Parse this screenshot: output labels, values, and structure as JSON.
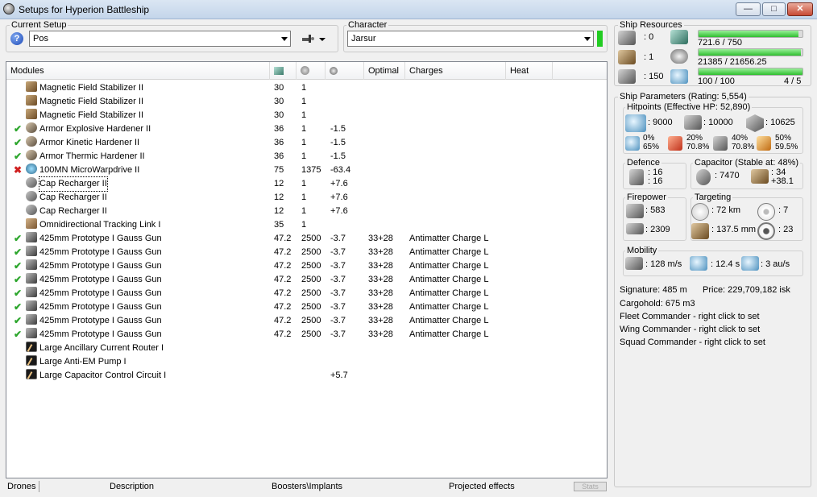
{
  "window": {
    "title": "Setups for Hyperion Battleship",
    "minimize": "—",
    "maximize": "□",
    "close": "✕"
  },
  "current_setup": {
    "label": "Current Setup",
    "value": "Pos",
    "help_icon": "?"
  },
  "character": {
    "label": "Character",
    "value": "Jarsur",
    "status_color": "#22cc22"
  },
  "modules": {
    "columns": [
      "Modules",
      "",
      "",
      "",
      "Optimal",
      "Charges",
      "Heat"
    ],
    "column_icons": [
      "cpu-icon",
      "powergrid-icon",
      "capacitor-icon"
    ],
    "rows": [
      {
        "status": "",
        "icon": "magnetic-field-stabilizer-icon",
        "name": "Magnetic Field Stabilizer II",
        "cpu": "30",
        "pg": "1",
        "cap": "",
        "optimal": "",
        "charge": ""
      },
      {
        "status": "",
        "icon": "magnetic-field-stabilizer-icon",
        "name": "Magnetic Field Stabilizer II",
        "cpu": "30",
        "pg": "1",
        "cap": "",
        "optimal": "",
        "charge": ""
      },
      {
        "status": "",
        "icon": "magnetic-field-stabilizer-icon",
        "name": "Magnetic Field Stabilizer II",
        "cpu": "30",
        "pg": "1",
        "cap": "",
        "optimal": "",
        "charge": ""
      },
      {
        "status": "✔",
        "icon": "armor-hardener-icon",
        "name": "Armor Explosive Hardener II",
        "cpu": "36",
        "pg": "1",
        "cap": "-1.5",
        "optimal": "",
        "charge": ""
      },
      {
        "status": "✔",
        "icon": "armor-hardener-icon",
        "name": "Armor Kinetic Hardener II",
        "cpu": "36",
        "pg": "1",
        "cap": "-1.5",
        "optimal": "",
        "charge": ""
      },
      {
        "status": "✔",
        "icon": "armor-hardener-icon",
        "name": "Armor Thermic Hardener II",
        "cpu": "36",
        "pg": "1",
        "cap": "-1.5",
        "optimal": "",
        "charge": ""
      },
      {
        "status": "✖",
        "icon": "microwarpdrive-icon",
        "name": "100MN MicroWarpdrive II",
        "cpu": "75",
        "pg": "1375",
        "cap": "-63.4",
        "optimal": "",
        "charge": ""
      },
      {
        "status": "",
        "icon": "cap-recharger-icon",
        "name": "Cap Recharger II",
        "cpu": "12",
        "pg": "1",
        "cap": "+7.6",
        "optimal": "",
        "charge": ""
      },
      {
        "status": "",
        "icon": "cap-recharger-icon",
        "name": "Cap Recharger II",
        "cpu": "12",
        "pg": "1",
        "cap": "+7.6",
        "optimal": "",
        "charge": ""
      },
      {
        "status": "",
        "icon": "cap-recharger-icon",
        "name": "Cap Recharger II",
        "cpu": "12",
        "pg": "1",
        "cap": "+7.6",
        "optimal": "",
        "charge": ""
      },
      {
        "status": "",
        "icon": "tracking-link-icon",
        "name": "Omnidirectional Tracking Link I",
        "cpu": "35",
        "pg": "1",
        "cap": "",
        "optimal": "",
        "charge": ""
      },
      {
        "status": "✔",
        "icon": "gauss-gun-icon",
        "name": "425mm Prototype I Gauss Gun",
        "cpu": "47.2",
        "pg": "2500",
        "cap": "-3.7",
        "optimal": "33+28",
        "charge": "Antimatter Charge L"
      },
      {
        "status": "✔",
        "icon": "gauss-gun-icon",
        "name": "425mm Prototype I Gauss Gun",
        "cpu": "47.2",
        "pg": "2500",
        "cap": "-3.7",
        "optimal": "33+28",
        "charge": "Antimatter Charge L"
      },
      {
        "status": "✔",
        "icon": "gauss-gun-icon",
        "name": "425mm Prototype I Gauss Gun",
        "cpu": "47.2",
        "pg": "2500",
        "cap": "-3.7",
        "optimal": "33+28",
        "charge": "Antimatter Charge L"
      },
      {
        "status": "✔",
        "icon": "gauss-gun-icon",
        "name": "425mm Prototype I Gauss Gun",
        "cpu": "47.2",
        "pg": "2500",
        "cap": "-3.7",
        "optimal": "33+28",
        "charge": "Antimatter Charge L"
      },
      {
        "status": "✔",
        "icon": "gauss-gun-icon",
        "name": "425mm Prototype I Gauss Gun",
        "cpu": "47.2",
        "pg": "2500",
        "cap": "-3.7",
        "optimal": "33+28",
        "charge": "Antimatter Charge L"
      },
      {
        "status": "✔",
        "icon": "gauss-gun-icon",
        "name": "425mm Prototype I Gauss Gun",
        "cpu": "47.2",
        "pg": "2500",
        "cap": "-3.7",
        "optimal": "33+28",
        "charge": "Antimatter Charge L"
      },
      {
        "status": "✔",
        "icon": "gauss-gun-icon",
        "name": "425mm Prototype I Gauss Gun",
        "cpu": "47.2",
        "pg": "2500",
        "cap": "-3.7",
        "optimal": "33+28",
        "charge": "Antimatter Charge L"
      },
      {
        "status": "✔",
        "icon": "gauss-gun-icon",
        "name": "425mm Prototype I Gauss Gun",
        "cpu": "47.2",
        "pg": "2500",
        "cap": "-3.7",
        "optimal": "33+28",
        "charge": "Antimatter Charge L"
      },
      {
        "status": "",
        "icon": "rig-icon",
        "name": "Large Ancillary Current Router I",
        "cpu": "",
        "pg": "",
        "cap": "",
        "optimal": "",
        "charge": ""
      },
      {
        "status": "",
        "icon": "rig-icon",
        "name": "Large Anti-EM Pump I",
        "cpu": "",
        "pg": "",
        "cap": "",
        "optimal": "",
        "charge": ""
      },
      {
        "status": "",
        "icon": "rig-icon",
        "name": "Large Capacitor Control Circuit I",
        "cpu": "",
        "pg": "",
        "cap": "+5.7",
        "optimal": "",
        "charge": ""
      }
    ]
  },
  "bottom_tabs": [
    "Drones",
    "Description",
    "Boosters\\Implants",
    "Projected effects"
  ],
  "stats_button": "Stats",
  "ship_resources": {
    "label": "Ship Resources",
    "hardpoints": [
      {
        "icon": "turret-hardpoint-icon",
        "value": ": 0"
      },
      {
        "icon": "launcher-hardpoint-icon",
        "value": ": 1"
      },
      {
        "icon": "calibration-icon",
        "value": ": 150"
      }
    ],
    "cpu": {
      "icon": "cpu-icon",
      "text": "721.6 / 750",
      "fraction": 0.962
    },
    "powergrid": {
      "icon": "powergrid-icon",
      "text": "21385 / 21656.25",
      "fraction": 0.987
    },
    "calibration": {
      "icon": "calibration-bar-icon",
      "text": "100 / 100",
      "fraction": 1.0
    },
    "rig_slots": "4 / 5"
  },
  "ship_parameters": {
    "label": "Ship Parameters (Rating: 5,554)",
    "hitpoints": {
      "label": "Hitpoints (Effective HP: 52,890)",
      "shield": ": 9000",
      "armor": ": 10000",
      "structure": ": 10625",
      "resists": [
        {
          "icon": "em-resist-icon",
          "top": "0%",
          "bottom": "65%"
        },
        {
          "icon": "thermal-resist-icon",
          "top": "20%",
          "bottom": "70.8%"
        },
        {
          "icon": "kinetic-resist-icon",
          "top": "40%",
          "bottom": "70.8%"
        },
        {
          "icon": "explosive-resist-icon",
          "top": "50%",
          "bottom": "59.5%"
        }
      ]
    },
    "defence": {
      "label": "Defence",
      "line1": ": 16",
      "line2": ": 16"
    },
    "capacitor": {
      "label": "Capacitor (Stable at: 48%)",
      "amount": ": 7470",
      "top": ": 34",
      "bottom": "+38.1"
    },
    "firepower": {
      "label": "Firepower",
      "dps": ": 583",
      "volley": ": 2309"
    },
    "targeting": {
      "label": "Targeting",
      "range": ": 72 km",
      "targets": ": 7",
      "scan_res": ": 137.5 mm",
      "sensor": ": 23"
    },
    "mobility": {
      "label": "Mobility",
      "speed": ": 128 m/s",
      "align": ": 12.4 s",
      "warp": ": 3 au/s"
    },
    "signature": "Signature: 485 m",
    "price": "Price: 229,709,182 isk",
    "cargohold": "Cargohold: 675 m3",
    "fleet_commander": "Fleet Commander - right click to set",
    "wing_commander": "Wing Commander - right click to set",
    "squad_commander": "Squad Commander - right click to set"
  }
}
